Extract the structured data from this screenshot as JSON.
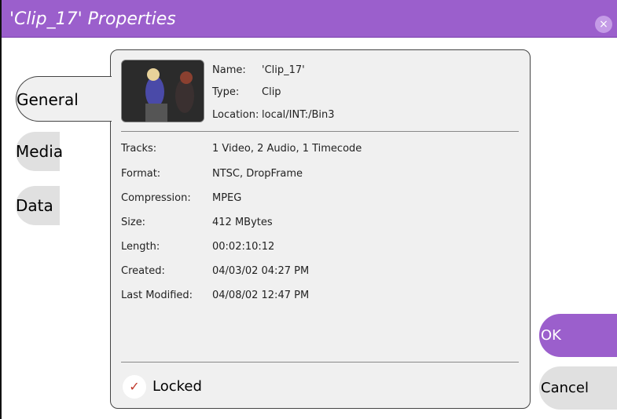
{
  "window": {
    "title": "'Clip_17' Properties",
    "close_icon": "×"
  },
  "tabs": [
    {
      "label": "General"
    },
    {
      "label": "Media"
    },
    {
      "label": "Data"
    }
  ],
  "clip": {
    "name_label": "Name:",
    "name_value": "'Clip_17'",
    "type_label": "Type:",
    "type_value": "Clip",
    "location_label": "Location:",
    "location_value": "local/INT:/Bin3"
  },
  "properties": [
    {
      "label": "Tracks:",
      "value": "1 Video, 2 Audio, 1 Timecode"
    },
    {
      "label": "Format:",
      "value": "NTSC, DropFrame"
    },
    {
      "label": "Compression:",
      "value": "MPEG"
    },
    {
      "label": "Size:",
      "value": "412 MBytes"
    },
    {
      "label": "Length:",
      "value": "00:02:10:12"
    },
    {
      "label": "Created:",
      "value": "04/03/02 04:27 PM"
    },
    {
      "label": "Last Modified:",
      "value": "04/08/02 12:47 PM"
    }
  ],
  "locked": {
    "label": "Locked",
    "checked": true,
    "check_glyph": "✓"
  },
  "buttons": {
    "ok": "OK",
    "cancel": "Cancel"
  },
  "colors": {
    "accent": "#9b5fcc",
    "panel": "#f0f0f0",
    "tab": "#e0e0e0"
  }
}
